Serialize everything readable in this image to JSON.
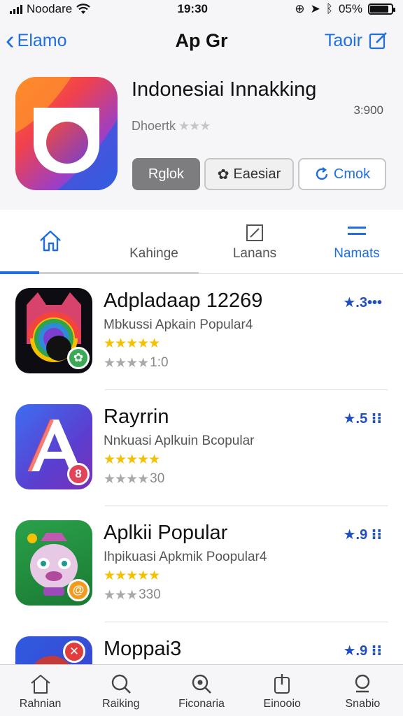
{
  "status_bar": {
    "carrier": "Noodare",
    "time": "19:30",
    "battery_pct": "05%",
    "battery_level": 0.85
  },
  "nav": {
    "back_label": "Elamo",
    "title": "Ap Gr",
    "right_label": "Taoir"
  },
  "app": {
    "title": "Indonesiai Innakking",
    "price": "3:900",
    "subtitle": "Dhoertk",
    "stars": "★★★",
    "buttons": {
      "primary": "Rglok",
      "secondary": "Eaesiar",
      "outline": "Cmok"
    }
  },
  "tabs": [
    {
      "label": "",
      "icon": "home-icon"
    },
    {
      "label": "Kahinge",
      "icon": ""
    },
    {
      "label": "Lanans",
      "icon": "edit-icon"
    },
    {
      "label": "Namats",
      "icon": "menu-icon"
    }
  ],
  "apps": [
    {
      "title": "Adpladaap 12269",
      "subtitle": "Mbkussi Apkain Popular4",
      "gold_stars": "★★★★★",
      "grey_stars": "★★★★",
      "count": "1:0",
      "score": "★.3•••",
      "icon": "rainbow-cat-icon",
      "badge_color": "#3aaa56"
    },
    {
      "title": "Rayrrin",
      "subtitle": "Nnkuasi Aplkuin Bcopular",
      "gold_stars": "★★★★★",
      "grey_stars": "★★★★",
      "count": "30",
      "score": "★.5 ⁝⁝",
      "icon": "letter-a-icon",
      "badge_color": "#e2455a"
    },
    {
      "title": "Aplkii Popular",
      "subtitle": "Ihpikuasi Apkmik Poopular4",
      "gold_stars": "★★★★★",
      "grey_stars": "★★★",
      "count": "330",
      "score": "★.9 ⁝⁝",
      "icon": "pig-mascot-icon",
      "badge_color": "#f29b1f"
    },
    {
      "title": "Moppai3",
      "subtitle": "",
      "gold_stars": "",
      "grey_stars": "",
      "count": "",
      "score": "★.9 ⁝⁝",
      "icon": "red-circle-icon",
      "badge_color": "#e23d3d"
    }
  ],
  "tab_bar": [
    {
      "label": "Rahnian",
      "icon": "home-icon"
    },
    {
      "label": "Raiking",
      "icon": "search-icon"
    },
    {
      "label": "Ficonaria",
      "icon": "magnifier-plus-icon"
    },
    {
      "label": "Einooio",
      "icon": "download-icon"
    },
    {
      "label": "Snabio",
      "icon": "search-icon"
    }
  ],
  "colors": {
    "accent": "#1f6fe0",
    "score": "#1f4fbf",
    "gold": "#f5c000"
  }
}
